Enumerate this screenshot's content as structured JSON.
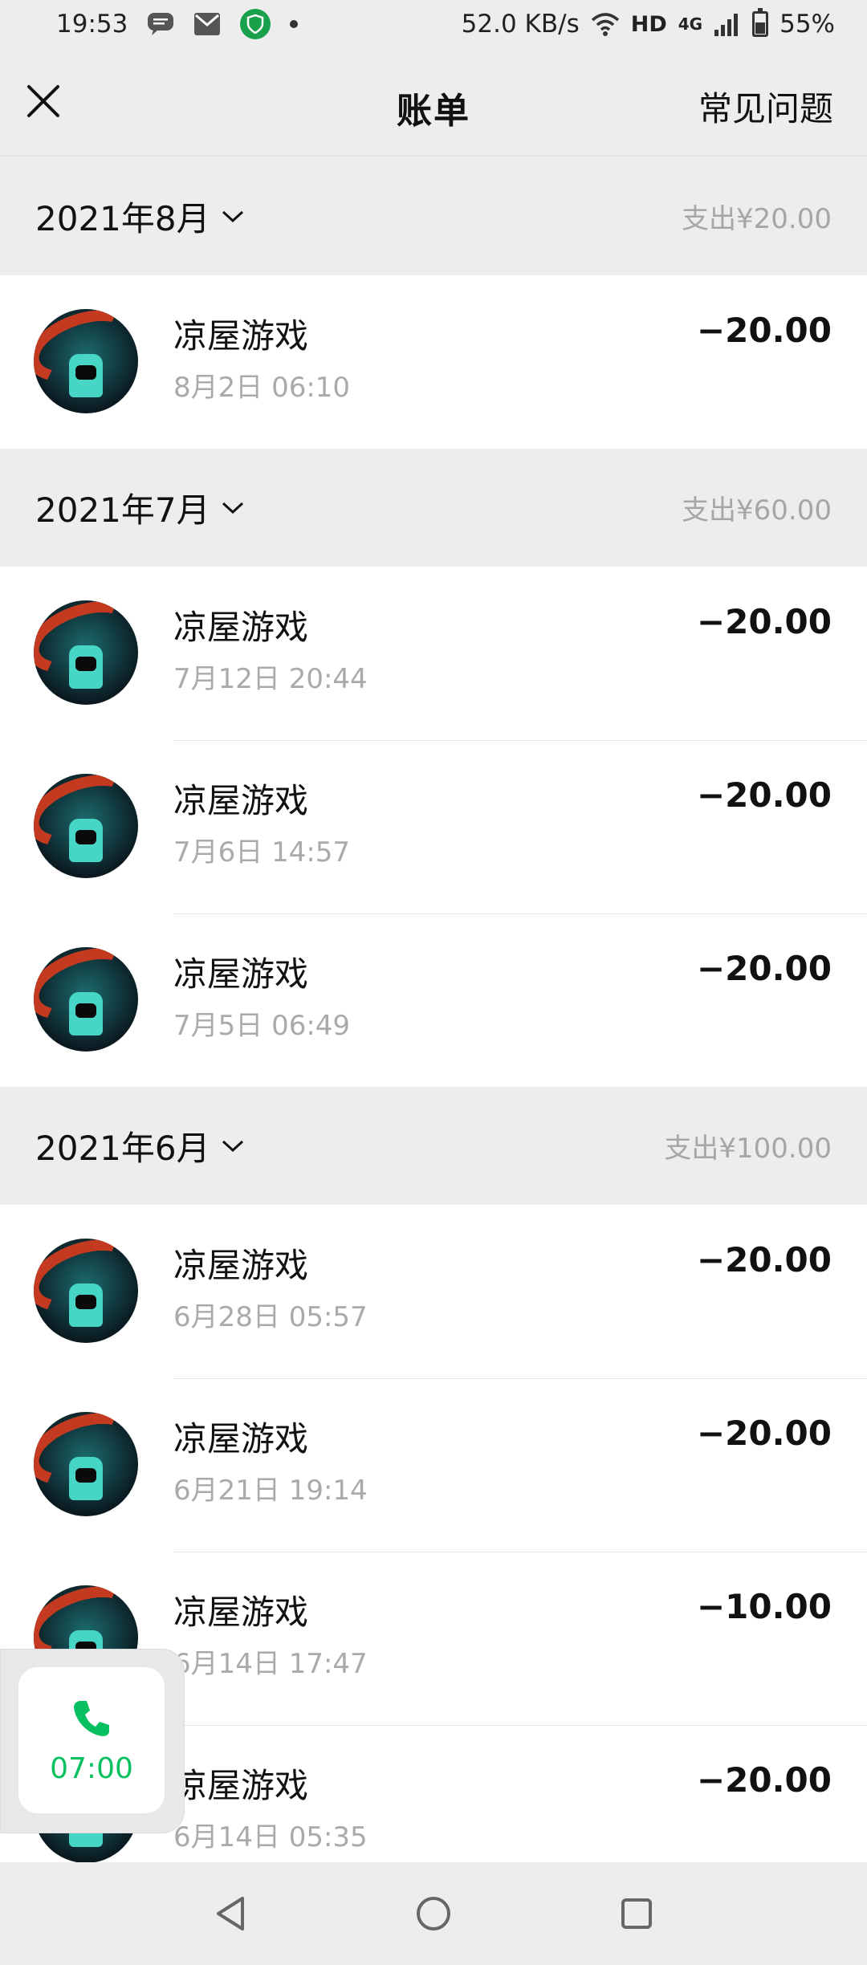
{
  "status": {
    "time": "19:53",
    "network_speed": "52.0 KB/s",
    "hd": "HD",
    "signal_type": "4G",
    "battery": "55%"
  },
  "header": {
    "title": "账单",
    "faq_label": "常见问题"
  },
  "months": [
    {
      "label": "2021年8月",
      "total": "支出¥20.00",
      "items": [
        {
          "title": "凉屋游戏",
          "time": "8月2日 06:10",
          "amount": "−20.00"
        }
      ]
    },
    {
      "label": "2021年7月",
      "total": "支出¥60.00",
      "items": [
        {
          "title": "凉屋游戏",
          "time": "7月12日 20:44",
          "amount": "−20.00"
        },
        {
          "title": "凉屋游戏",
          "time": "7月6日 14:57",
          "amount": "−20.00"
        },
        {
          "title": "凉屋游戏",
          "time": "7月5日 06:49",
          "amount": "−20.00"
        }
      ]
    },
    {
      "label": "2021年6月",
      "total": "支出¥100.00",
      "items": [
        {
          "title": "凉屋游戏",
          "time": "6月28日 05:57",
          "amount": "−20.00"
        },
        {
          "title": "凉屋游戏",
          "time": "6月21日 19:14",
          "amount": "−20.00"
        },
        {
          "title": "凉屋游戏",
          "time": "6月14日 17:47",
          "amount": "−10.00"
        },
        {
          "title": "凉屋游戏",
          "time": "6月14日 05:35",
          "amount": "−20.00"
        }
      ]
    }
  ],
  "call_widget": {
    "time": "07:00",
    "color": "#07c160"
  }
}
